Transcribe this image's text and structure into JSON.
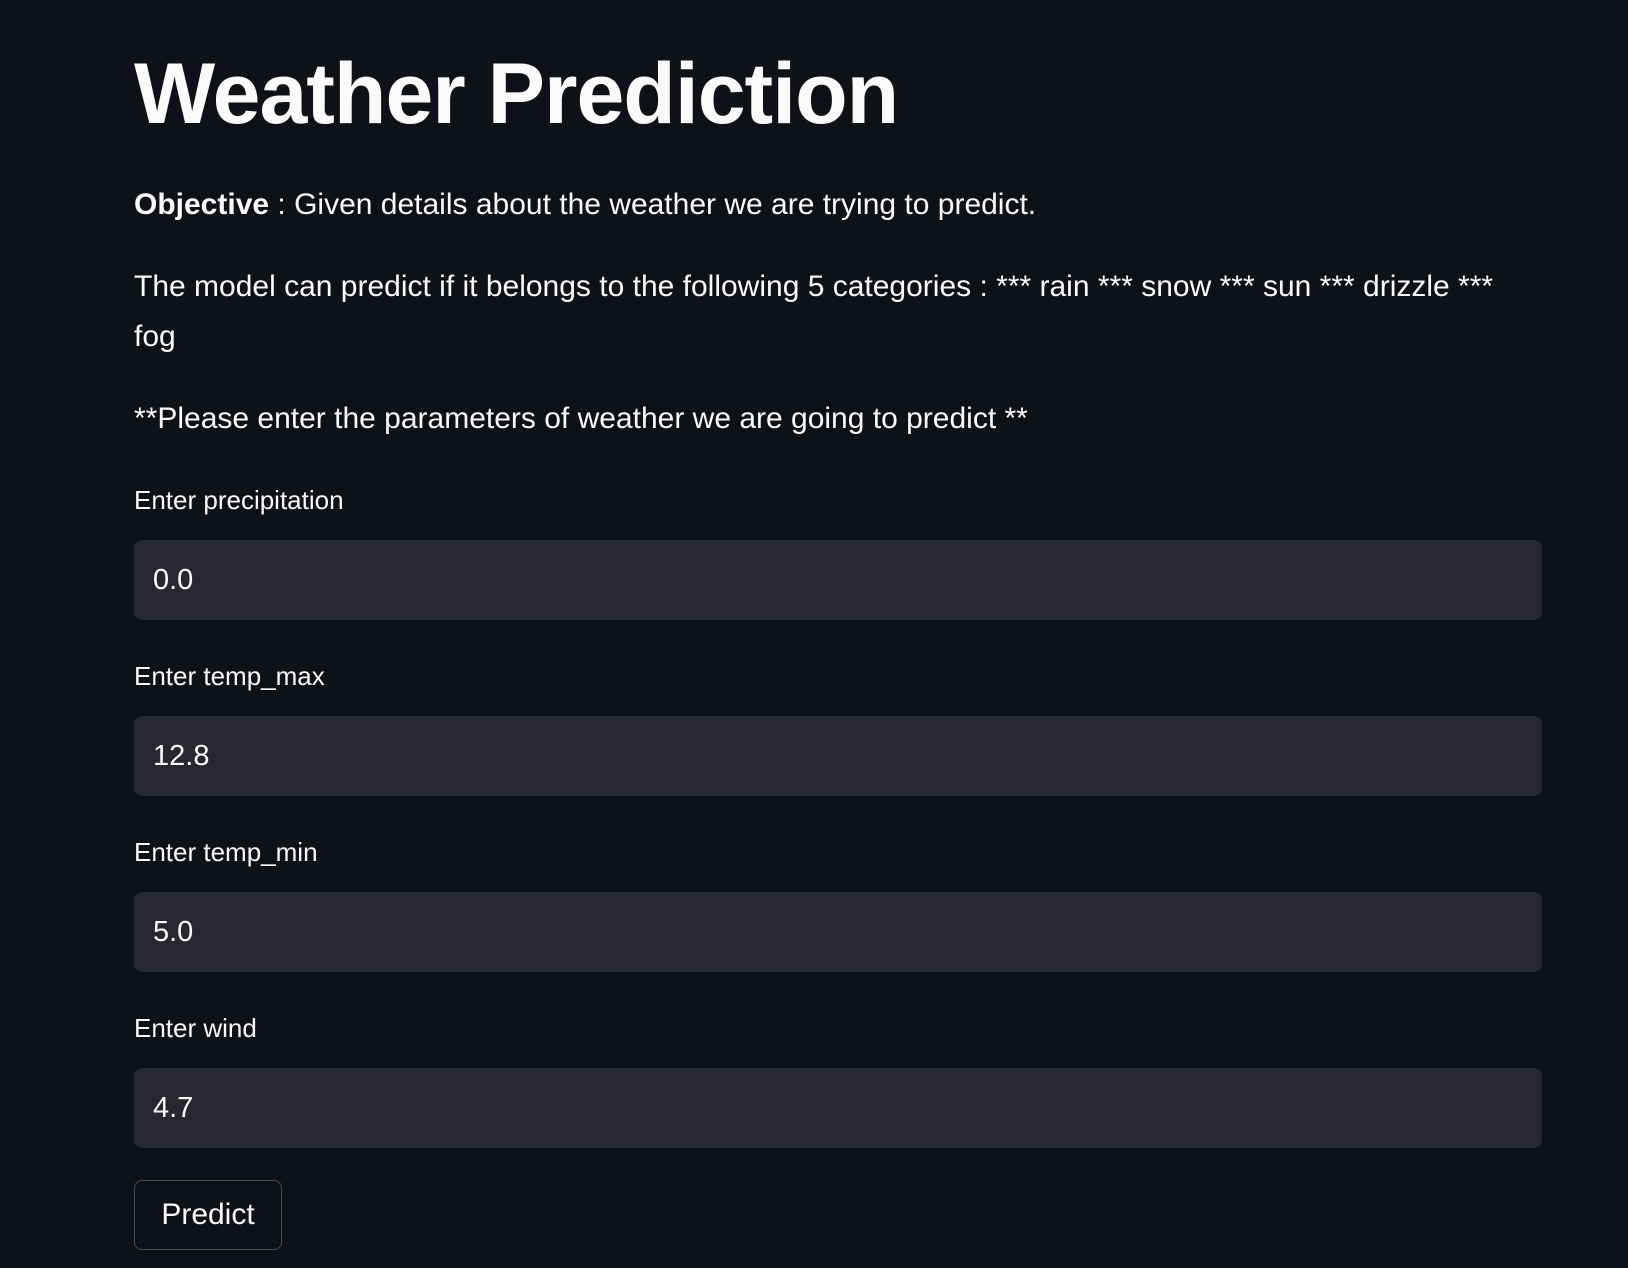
{
  "title": "Weather Prediction",
  "objective": {
    "label": "Objective",
    "text": " : Given details about the weather we are trying to predict."
  },
  "categories_text": "The model can predict if it belongs to the following 5 categories : *** rain *** snow *** sun *** drizzle *** fog",
  "instruction": "**Please enter the parameters of weather we are going to predict **",
  "fields": [
    {
      "label": "Enter precipitation",
      "value": "0.0"
    },
    {
      "label": "Enter temp_max",
      "value": "12.8"
    },
    {
      "label": "Enter temp_min",
      "value": "5.0"
    },
    {
      "label": "Enter wind",
      "value": "4.7"
    }
  ],
  "predict_label": "Predict"
}
